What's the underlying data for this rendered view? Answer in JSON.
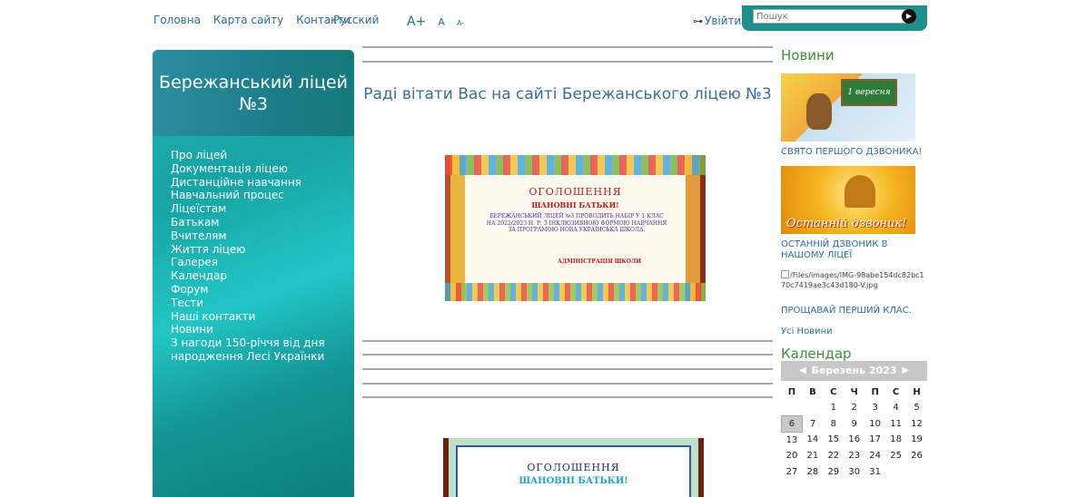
{
  "topnav": {
    "home": "Головна",
    "sitemap": "Карта сайту",
    "contacts": "Контакти",
    "language": "Русский",
    "font_large": "A+",
    "font_normal": "A",
    "font_small": "A-",
    "login": "Увійти",
    "login_icon": "key-icon",
    "search_placeholder": "Пошук",
    "search_button_icon": "arrow-right-icon"
  },
  "sidebar": {
    "title": "Бережанський ліцей №3",
    "items": [
      "Про ліцей",
      "Документація ліцею",
      "Дистанційне навчання",
      "Навчальний процес",
      "Ліцеїстам",
      "Батькам",
      "Вчителям",
      "Життя ліцею",
      "Галерея",
      "Календар",
      "Форум",
      "Тести",
      "Наші контакти",
      "Новини",
      "З нагоди 150-річчя від дня народження Лесі Українки"
    ]
  },
  "main": {
    "welcome": "Раді вітати Вас на сайті Бережанського ліцею №3",
    "banner1": {
      "title": "ОГОЛОШЕННЯ",
      "subtitle": "ШАНОВНІ БАТЬКИ!",
      "body": "БЕРЕЖАНСЬКИЙ ЛІЦЕЙ №3 ПРОВОДИТЬ НАБІР У 1 КЛАС НА 2022/2023 Н. Р. З ІНКЛЮЗИВНОЮ ФОРМОЮ НАВЧАННЯ ЗА ПРОГРАМОЮ НОВА УКРАЇНСЬКА ШКОЛА.",
      "signature": "АДМІНІСТРАЦІЯ ШКОЛИ"
    },
    "banner2": {
      "title": "ОГОЛОШЕННЯ",
      "subtitle": "ШАНОВНІ БАТЬКИ!"
    }
  },
  "news": {
    "heading": "Новини",
    "item1_image_text": "1 вересня",
    "item1_title": "СВЯТО ПЕРШОГО ДЗВОНИКА!",
    "item2_image_text": "Останній дзвоник!",
    "item2_title": "ОСТАННІЙ ДЗВОНИК В НАШОМУ ЛІЦЕЇ",
    "item3_broken_image": "/Files/images/IMG-98abe154dc82bc170c7419ae3c43d180-V.jpg",
    "item3_title": "ПРОЩАВАЙ ПЕРШИЙ КЛАС.",
    "all_news": "Усі Новини"
  },
  "calendar": {
    "heading": "Календар",
    "month": "Березень 2023",
    "weekdays": [
      "П",
      "В",
      "С",
      "Ч",
      "П",
      "С",
      "Н"
    ],
    "weeks": [
      [
        "",
        "",
        "1",
        "2",
        "3",
        "4",
        "5"
      ],
      [
        "6",
        "7",
        "8",
        "9",
        "10",
        "11",
        "12"
      ],
      [
        "13",
        "14",
        "15",
        "16",
        "17",
        "18",
        "19"
      ],
      [
        "20",
        "21",
        "22",
        "23",
        "24",
        "25",
        "26"
      ],
      [
        "27",
        "28",
        "29",
        "30",
        "31",
        "",
        ""
      ]
    ],
    "today": "6"
  }
}
